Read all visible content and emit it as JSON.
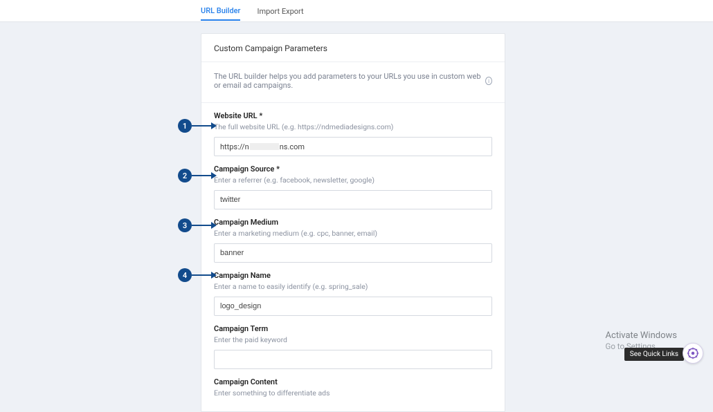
{
  "tabs": {
    "builder": "URL Builder",
    "import": "Import Export"
  },
  "card": {
    "title": "Custom Campaign Parameters",
    "desc": "The URL builder helps you add parameters to your URLs you use in custom web or email ad campaigns."
  },
  "fields": {
    "url": {
      "label": "Website URL *",
      "hint": "The full website URL (e.g. https://ndmediadesigns.com)",
      "value_pre": "https://n",
      "value_post": "ns.com"
    },
    "source": {
      "label": "Campaign Source *",
      "hint": "Enter a referrer (e.g. facebook, newsletter, google)",
      "value": "twitter"
    },
    "medium": {
      "label": "Campaign Medium",
      "hint": "Enter a marketing medium (e.g. cpc, banner, email)",
      "value": "banner"
    },
    "name": {
      "label": "Campaign Name",
      "hint": "Enter a name to easily identify (e.g. spring_sale)",
      "value": "logo_design"
    },
    "term": {
      "label": "Campaign Term",
      "hint": "Enter the paid keyword",
      "value": ""
    },
    "content": {
      "label": "Campaign Content",
      "hint": "Enter something to differentiate ads",
      "value": ""
    }
  },
  "callouts": {
    "1": "1",
    "2": "2",
    "3": "3",
    "4": "4"
  },
  "footer": {
    "activate_title": "Activate Windows",
    "activate_sub": "Go to Settings",
    "quicklinks": "See Quick Links"
  }
}
